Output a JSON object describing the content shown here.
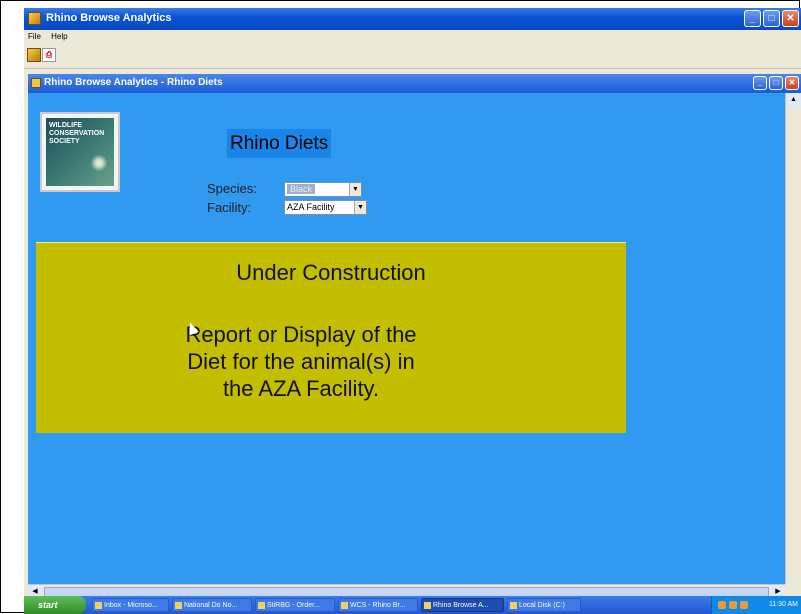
{
  "app": {
    "title": "Rhino Browse Analytics",
    "menu": [
      "File",
      "Help"
    ],
    "window_controls": [
      "minimize-icon",
      "maximize-icon",
      "close-icon"
    ]
  },
  "child": {
    "title": "Rhino Browse Analytics - Rhino Diets",
    "window_controls": [
      "minimize-icon",
      "maximize-icon",
      "close-icon"
    ]
  },
  "logo": {
    "text": "WILDLIFE CONSERVATION SOCIETY"
  },
  "form": {
    "title": "Rhino Diets",
    "species_label": "Species:",
    "species_value": "Black",
    "facility_label": "Facility:",
    "facility_value": "AZA Facility"
  },
  "panel": {
    "title": "Under Construction",
    "body_lines": [
      "Report or Display of the",
      "Diet for the animal(s) in",
      "the AZA Facility."
    ]
  },
  "taskbar": {
    "start_label": "start",
    "tasks": [
      "Inbox - Microso...",
      "National Do No...",
      "StiRBG - Order...",
      "WCS - Rhino Br...",
      "Rhino Browse A...",
      "Local Disk (C:)"
    ],
    "active_task": 4,
    "clock": "11:30 AM"
  },
  "colors": {
    "child_background": "#2f9af0",
    "panel_background": "#c4be00",
    "title_highlight": "#1a85e8"
  }
}
